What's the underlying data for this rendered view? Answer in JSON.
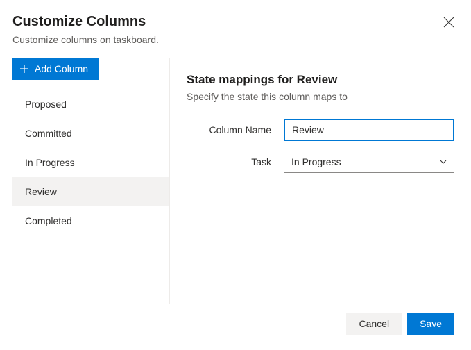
{
  "header": {
    "title": "Customize Columns",
    "subtitle": "Customize columns on taskboard."
  },
  "sidebar": {
    "add_button_label": "Add Column",
    "items": [
      {
        "label": "Proposed",
        "selected": false
      },
      {
        "label": "Committed",
        "selected": false
      },
      {
        "label": "In Progress",
        "selected": false
      },
      {
        "label": "Review",
        "selected": true
      },
      {
        "label": "Completed",
        "selected": false
      }
    ]
  },
  "main": {
    "section_title": "State mappings for Review",
    "section_subtitle": "Specify the state this column maps to",
    "column_name_label": "Column Name",
    "column_name_value": "Review",
    "task_label": "Task",
    "task_value": "In Progress"
  },
  "footer": {
    "cancel_label": "Cancel",
    "save_label": "Save"
  }
}
